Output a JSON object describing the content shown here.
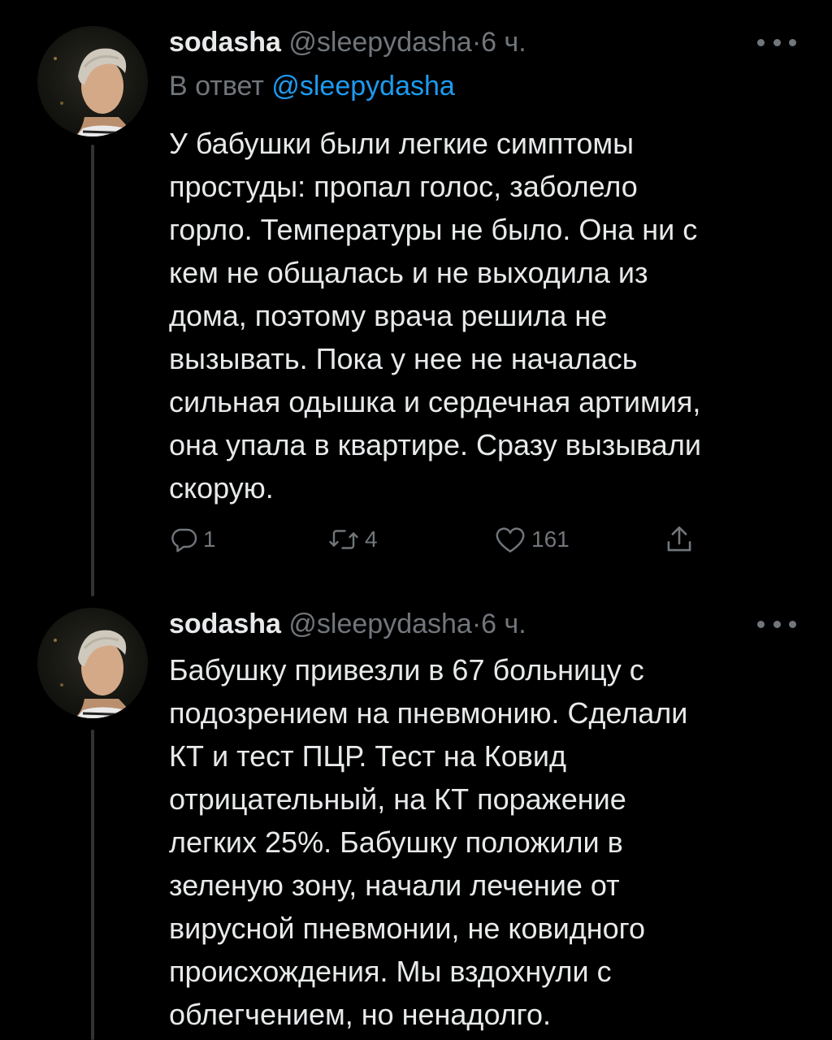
{
  "tweets": [
    {
      "author": "sodasha",
      "handle": "@sleepydasha",
      "separator": "·",
      "time": "6 ч.",
      "reply_prefix": "В ответ",
      "reply_mention": "@sleepydasha",
      "text": "У бабушки были легкие симптомы\nпростуды: пропал голос, заболело\nгорло. Температуры не было. Она ни с\nкем не общалась и не выходила из\nдома, поэтому врача решила не\nвызывать. Пока у нее не началась\nсильная одышка и сердечная артимия,\nона упала в квартире. Сразу вызывали\nскорую.",
      "stats": {
        "replies": "1",
        "retweets": "4",
        "likes": "161"
      }
    },
    {
      "author": "sodasha",
      "handle": "@sleepydasha",
      "separator": "·",
      "time": "6 ч.",
      "text": "Бабушку привезли в 67 больницу с\nподозрением на пневмонию. Сделали\nКТ и тест ПЦР. Тест на Ковид\nотрицательный, на КТ поражение\nлегких 25%. Бабушку положили в\nзеленую зону, начали лечение от\nвирусной пневмонии, не ковидного\nпроисхождения. Мы вздохнули с\nоблегчением, но ненадолго."
    }
  ],
  "icons": {
    "reply": "reply-icon",
    "retweet": "retweet-icon",
    "like": "heart-icon",
    "share": "share-icon",
    "more": "more-icon"
  },
  "colors": {
    "background": "#000000",
    "text": "#e7e9ea",
    "secondary": "#71767b",
    "link": "#1d9bf0",
    "thread_line": "#2f3336"
  }
}
